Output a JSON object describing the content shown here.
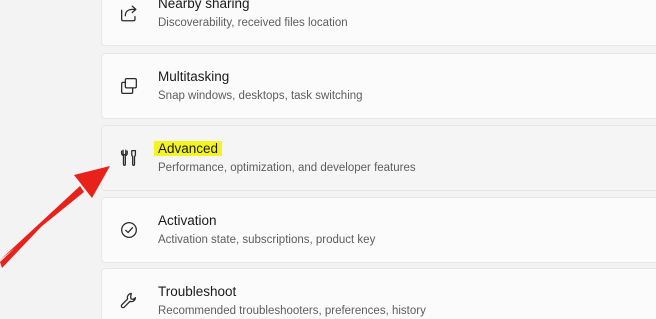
{
  "settings_list": {
    "items": [
      {
        "title": "Nearby sharing",
        "subtitle": "Discoverability, received files location",
        "icon": "share-icon"
      },
      {
        "title": "Multitasking",
        "subtitle": "Snap windows, desktops, task switching",
        "icon": "multitasking-icon"
      },
      {
        "title": "Advanced",
        "subtitle": "Performance, optimization, and developer features",
        "icon": "tools-icon",
        "highlighted": true
      },
      {
        "title": "Activation",
        "subtitle": "Activation state, subscriptions, product key",
        "icon": "checkmark-circle-icon"
      },
      {
        "title": "Troubleshoot",
        "subtitle": "Recommended troubleshooters, preferences, history",
        "icon": "wrench-icon"
      }
    ]
  },
  "annotation": {
    "arrow_color": "#e8211b",
    "highlight_color": "#f4f423"
  }
}
